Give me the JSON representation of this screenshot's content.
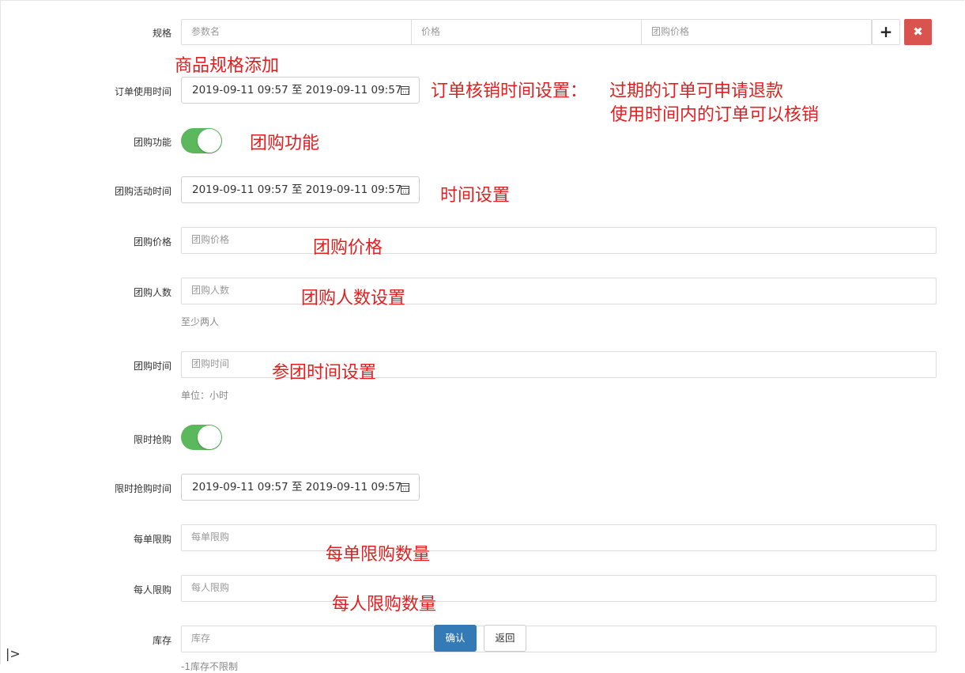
{
  "form": {
    "spec": {
      "label": "规格",
      "param_name_placeholder": "参数名",
      "price_placeholder": "价格",
      "group_price_placeholder": "团购价格",
      "add_symbol": "+",
      "remove_symbol": "✖"
    },
    "order_use_time": {
      "label": "订单使用时间",
      "value": "2019-09-11 09:57 至 2019-09-11 09:57"
    },
    "group_buy": {
      "label": "团购功能",
      "enabled": true
    },
    "group_activity_time": {
      "label": "团购活动时间",
      "value": "2019-09-11 09:57 至 2019-09-11 09:57"
    },
    "group_price": {
      "label": "团购价格",
      "placeholder": "团购价格"
    },
    "group_size": {
      "label": "团购人数",
      "placeholder": "团购人数",
      "help": "至少两人"
    },
    "group_time": {
      "label": "团购时间",
      "placeholder": "团购时间",
      "help": "单位：小时"
    },
    "flash_sale": {
      "label": "限时抢购",
      "enabled": true
    },
    "flash_sale_time": {
      "label": "限时抢购时间",
      "value": "2019-09-11 09:57 至 2019-09-11 09:57"
    },
    "per_order_limit": {
      "label": "每单限购",
      "placeholder": "每单限购"
    },
    "per_person_limit": {
      "label": "每人限购",
      "placeholder": "每人限购"
    },
    "stock": {
      "label": "库存",
      "placeholder": "库存",
      "help_cut": "-1库存不限制"
    },
    "confirm_label": "确认",
    "back_label": "返回"
  },
  "annotations": {
    "spec_add": "商品规格添加",
    "order_verify": "订单核销时间设置：",
    "order_note_1": "过期的订单可申请退款",
    "order_note_2": "使用时间内的订单可以核销",
    "group_feature": "团购功能",
    "time_setting": "时间设置",
    "group_price": "团购价格",
    "group_size": "团购人数设置",
    "join_time": "参团时间设置",
    "per_order_qty": "每单限购数量",
    "per_person_qty": "每人限购数量"
  },
  "colors": {
    "annotation": "#e02020",
    "toggle_on": "#5cb85c",
    "primary": "#337ab7",
    "danger": "#d9534f"
  },
  "icons": {
    "calendar": "calendar-icon",
    "plus": "plus-icon",
    "remove": "close-icon",
    "sidebar": "sidebar-toggle-icon"
  }
}
